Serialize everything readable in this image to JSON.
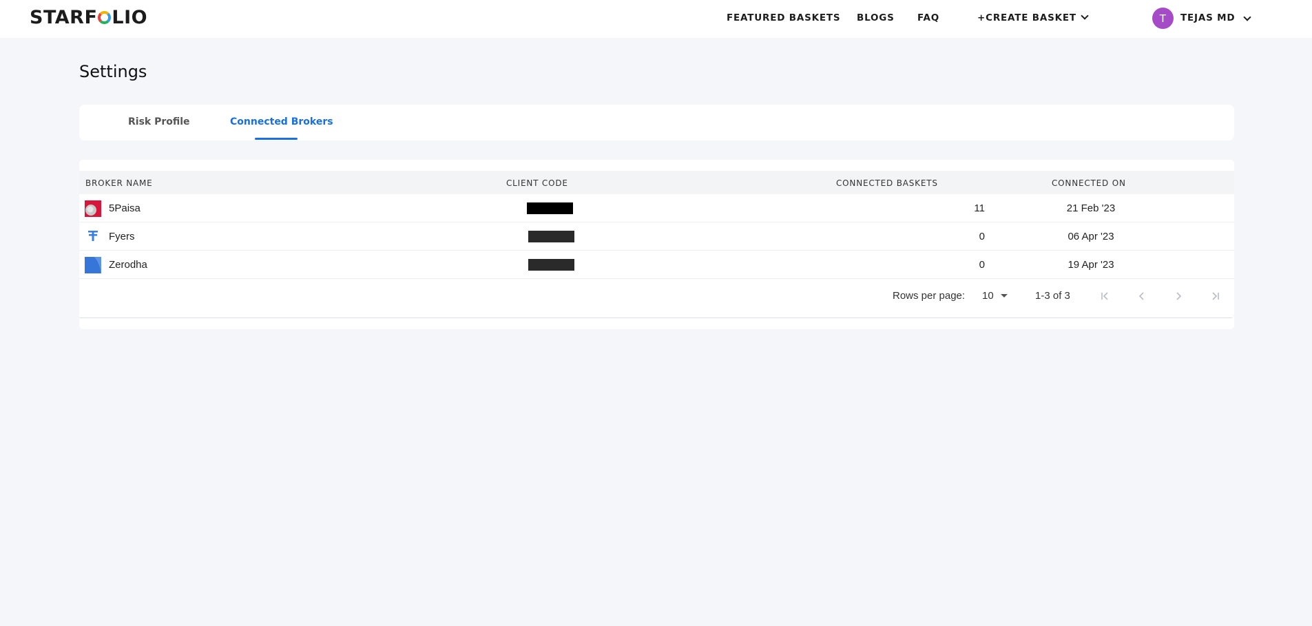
{
  "header": {
    "logo_pre": "STARF",
    "logo_post": "LIO",
    "nav": {
      "featured": "FEATURED BASKETS",
      "blogs": "BLOGS",
      "faq": "FAQ",
      "create": "+CREATE BASKET"
    },
    "user": {
      "initial": "T",
      "name": "TEJAS MD"
    }
  },
  "page": {
    "title": "Settings"
  },
  "tabs": [
    {
      "label": "Risk Profile",
      "active": false
    },
    {
      "label": "Connected Brokers",
      "active": true
    }
  ],
  "table": {
    "columns": [
      "BROKER NAME",
      "CLIENT CODE",
      "CONNECTED BASKETS",
      "CONNECTED ON"
    ],
    "rows": [
      {
        "broker": "5Paisa",
        "baskets": "11",
        "connected_on": "21 Feb '23"
      },
      {
        "broker": "Fyers",
        "baskets": "0",
        "connected_on": "06 Apr '23"
      },
      {
        "broker": "Zerodha",
        "baskets": "0",
        "connected_on": "19 Apr '23"
      }
    ]
  },
  "pagination": {
    "rows_per_page_label": "Rows per page:",
    "rows_per_page_value": "10",
    "range": "1-3 of 3"
  },
  "icons": {
    "first": "first-page-icon",
    "prev": "chevron-left-icon",
    "next": "chevron-right-icon",
    "last": "last-page-icon"
  },
  "colors": {
    "accent": "#1a6fe0",
    "avatar": "#a64bc8",
    "background": "#f5f6fa"
  }
}
